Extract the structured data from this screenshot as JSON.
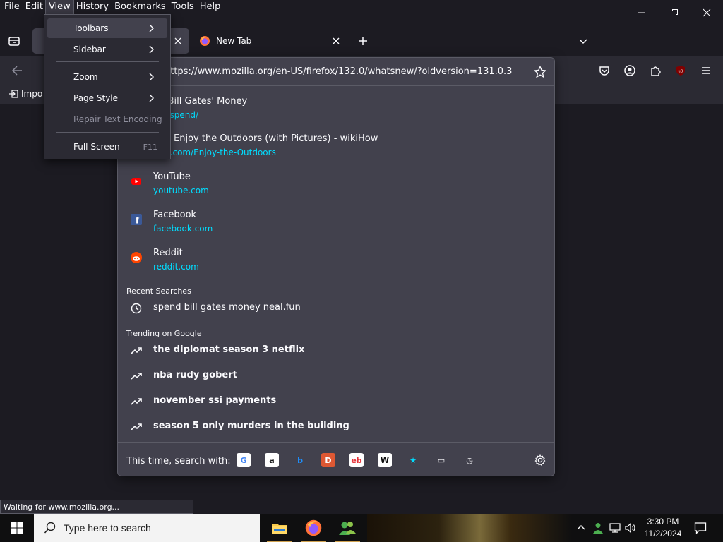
{
  "menubar": {
    "items": [
      "File",
      "Edit",
      "View",
      "History",
      "Bookmarks",
      "Tools",
      "Help"
    ]
  },
  "tabs": {
    "new_tab_title": "New Tab"
  },
  "bookmarks_bar": {
    "import_label": "Impo"
  },
  "urlbar": {
    "url": "https://www.mozilla.org/en-US/firefox/132.0/whatsnew/?oldversion=131.0.3",
    "results": [
      {
        "title": "nd Bill Gates' Money",
        "url": "fun/spend/",
        "icon": "none"
      },
      {
        "title": "y to Enjoy the Outdoors (with Pictures) - wikiHow",
        "url": "how.com/Enjoy-the-Outdoors",
        "icon": "none"
      },
      {
        "title": "YouTube",
        "url": "youtube.com",
        "icon": "youtube-icon"
      },
      {
        "title": "Facebook",
        "url": "facebook.com",
        "icon": "facebook-icon"
      },
      {
        "title": "Reddit",
        "url": "reddit.com",
        "icon": "reddit-icon"
      }
    ],
    "recent_searches_label": "Recent Searches",
    "recent_searches": [
      "spend bill gates money neal.fun"
    ],
    "trending_label": "Trending on Google",
    "trending": [
      "the diplomat season 3 netflix",
      "nba rudy gobert",
      "november ssi payments",
      "season 5 only murders in the building"
    ],
    "one_off_label": "This time, search with:",
    "engines": [
      {
        "name": "google-icon",
        "glyph": "G",
        "bg": "#ffffff",
        "fg": "#4285f4"
      },
      {
        "name": "amazon-icon",
        "glyph": "a",
        "bg": "#ffffff",
        "fg": "#111111"
      },
      {
        "name": "bing-icon",
        "glyph": "b",
        "bg": "transparent",
        "fg": "#1e90ff"
      },
      {
        "name": "duckduckgo-icon",
        "glyph": "D",
        "bg": "#de5833",
        "fg": "#ffffff"
      },
      {
        "name": "ebay-icon",
        "glyph": "eb",
        "bg": "#ffffff",
        "fg": "#e53238"
      },
      {
        "name": "wikipedia-icon",
        "glyph": "W",
        "bg": "#ffffff",
        "fg": "#111111"
      },
      {
        "name": "bookmarks-search-icon",
        "glyph": "★",
        "bg": "transparent",
        "fg": "#00ddff"
      },
      {
        "name": "tabs-search-icon",
        "glyph": "▭",
        "bg": "transparent",
        "fg": "#fbfbfe"
      },
      {
        "name": "history-search-icon",
        "glyph": "◷",
        "bg": "transparent",
        "fg": "#fbfbfe"
      }
    ]
  },
  "view_menu": {
    "items": [
      {
        "label": "Toolbars",
        "submenu": true,
        "disabled": false,
        "accel": ""
      },
      {
        "label": "Sidebar",
        "submenu": true,
        "disabled": false,
        "accel": ""
      },
      {
        "label": "Zoom",
        "submenu": true,
        "disabled": false,
        "accel": ""
      },
      {
        "label": "Page Style",
        "submenu": true,
        "disabled": false,
        "accel": ""
      },
      {
        "label": "Repair Text Encoding",
        "submenu": false,
        "disabled": true,
        "accel": ""
      },
      {
        "label": "Full Screen",
        "submenu": false,
        "disabled": false,
        "accel": "F11"
      }
    ]
  },
  "status": {
    "text": "Waiting for www.mozilla.org..."
  },
  "taskbar": {
    "search_placeholder": "Type here to search",
    "time": "3:30 PM",
    "date": "11/2/2024"
  },
  "colors": {
    "accent_link": "#00ddff",
    "panel_bg": "#42414d",
    "toolbar_bg": "#2b2a33"
  }
}
